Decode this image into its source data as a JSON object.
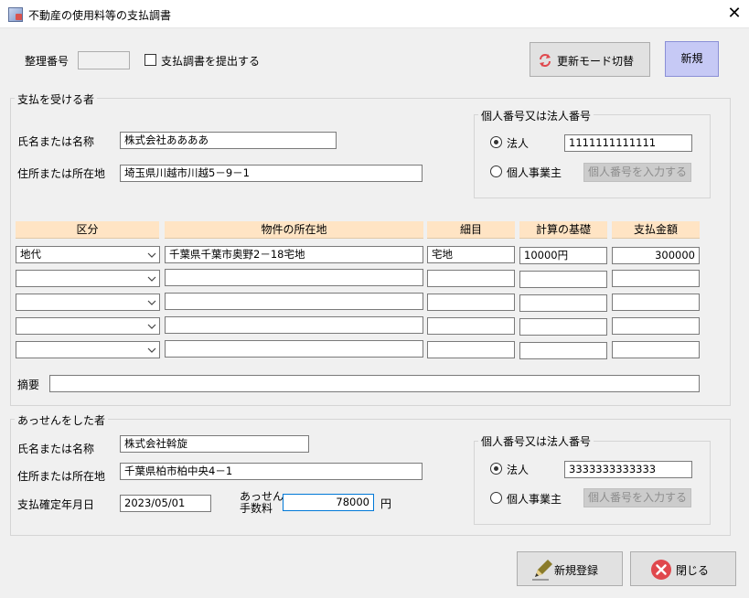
{
  "window": {
    "title": "不動産の使用料等の支払調書",
    "close_label": "✕"
  },
  "top": {
    "seiri_label": "整理番号",
    "seiri_value": "",
    "submit_checkbox_label": "支払調書を提出する",
    "mode_button_label": "更新モード切替",
    "new_button_label": "新規"
  },
  "payee": {
    "group_title": "支払を受ける者",
    "name_label": "氏名または名称",
    "name_value": "株式会社ああああ",
    "address_label": "住所または所在地",
    "address_value": "埼玉県川越市川越5－9－1",
    "number_group_title": "個人番号又は法人番号",
    "corp_label": "法人",
    "corp_value": "1111111111111",
    "individual_label": "個人事業主",
    "enter_number_button": "個人番号を入力する"
  },
  "table": {
    "headers": [
      "区分",
      "物件の所在地",
      "細目",
      "計算の基礎",
      "支払金額"
    ],
    "rows": [
      {
        "kubun": "地代",
        "location": "千葉県千葉市奥野2－18宅地",
        "detail": "宅地",
        "basis": "10000円",
        "amount": "300000"
      },
      {
        "kubun": "",
        "location": "",
        "detail": "",
        "basis": "",
        "amount": ""
      },
      {
        "kubun": "",
        "location": "",
        "detail": "",
        "basis": "",
        "amount": ""
      },
      {
        "kubun": "",
        "location": "",
        "detail": "",
        "basis": "",
        "amount": ""
      },
      {
        "kubun": "",
        "location": "",
        "detail": "",
        "basis": "",
        "amount": ""
      }
    ],
    "summary_label": "摘要",
    "summary_value": ""
  },
  "broker": {
    "group_title": "あっせんをした者",
    "name_label": "氏名または名称",
    "name_value": "株式会社斡旋",
    "address_label": "住所または所在地",
    "address_value": "千葉県柏市柏中央4－1",
    "date_label": "支払確定年月日",
    "date_value": "2023/05/01",
    "fee_label_line1": "あっせん",
    "fee_label_line2": "手数料",
    "fee_value": "78000",
    "fee_unit": "円",
    "number_group_title": "個人番号又は法人番号",
    "corp_label": "法人",
    "corp_value": "3333333333333",
    "individual_label": "個人事業主",
    "enter_number_button": "個人番号を入力する"
  },
  "footer": {
    "register_label": "新規登録",
    "close_label": "閉じる"
  },
  "colors": {
    "header_bg": "#ffe4c4",
    "new_button_bg": "#c6c9f5",
    "close_icon_red": "#e0484d",
    "refresh_icon_red": "#e0484d"
  }
}
